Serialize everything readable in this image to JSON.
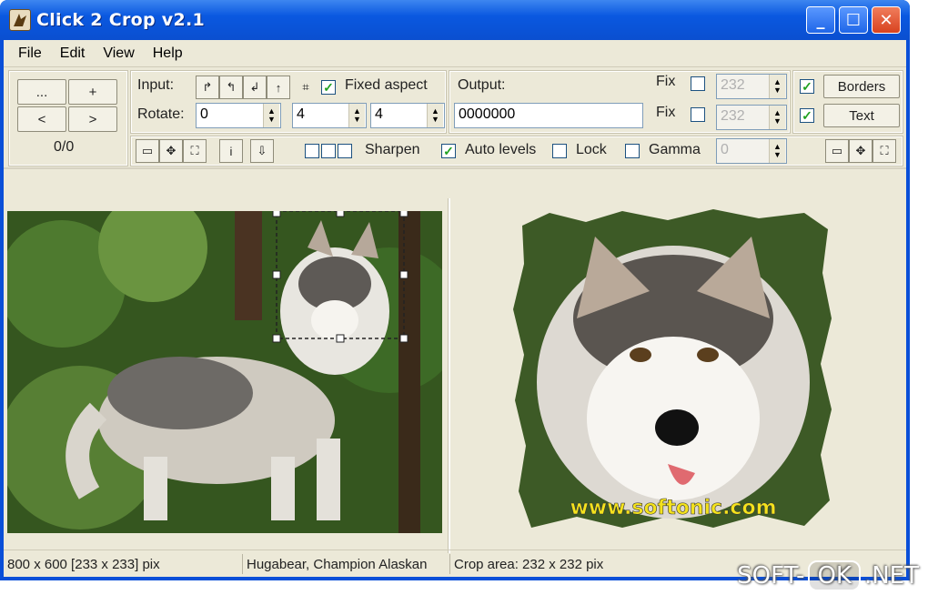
{
  "window": {
    "title": "Click 2 Crop v2.1"
  },
  "menu": [
    "File",
    "Edit",
    "View",
    "Help"
  ],
  "nav": {
    "btn_dots": "...",
    "btn_plus": "+",
    "btn_prev": "<",
    "btn_next": ">",
    "counter": "0/0"
  },
  "input": {
    "label": "Input:",
    "fixed_aspect_label": "Fixed aspect",
    "fixed_aspect_checked": true,
    "rotate_label": "Rotate:",
    "rotate_value": "0",
    "aspect_w": "4",
    "aspect_h": "4"
  },
  "output": {
    "label": "Output:",
    "value": "0000000",
    "fix1_label": "Fix",
    "fix1_value": "232",
    "fix2_label": "Fix",
    "fix2_value": "232",
    "borders_label": "Borders",
    "text_label": "Text"
  },
  "options": {
    "sharpen_label": "Sharpen",
    "auto_levels_label": "Auto levels",
    "auto_levels_checked": true,
    "lock_label": "Lock",
    "gamma_label": "Gamma",
    "gamma_value": "0"
  },
  "status": {
    "dimensions": "800 x 600  [233 x 233] pix",
    "caption": "Hugabear, Champion Alaskan",
    "crop_area": "Crop area: 232 x 232 pix"
  },
  "preview": {
    "watermark": "www.softonic.com"
  },
  "watermark": {
    "left": "SOFT-",
    "ok": "OK",
    "right": ".NET"
  }
}
